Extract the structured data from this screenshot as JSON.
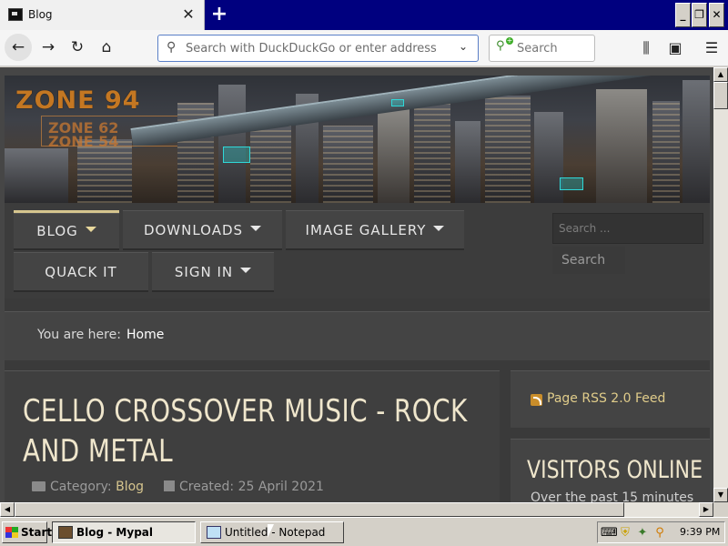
{
  "browser": {
    "tab_title": "Blog",
    "tab_close": "✕",
    "new_tab": "+",
    "url_placeholder": "Search with DuckDuckGo or enter address",
    "search_placeholder": "Search"
  },
  "window_controls": {
    "minimize": "_",
    "maximize": "❐",
    "close": "✕"
  },
  "site": {
    "logo": "ZONE 94",
    "logo_sub_1": "ZONE 62",
    "logo_sub_2": "ZONE 54",
    "menu": [
      {
        "label": "BLOG",
        "dropdown": true,
        "active": true
      },
      {
        "label": "DOWNLOADS",
        "dropdown": true
      },
      {
        "label": "IMAGE GALLERY",
        "dropdown": true
      },
      {
        "label": "QUACK IT",
        "dropdown": false
      },
      {
        "label": "SIGN IN",
        "dropdown": true
      }
    ],
    "search_placeholder": "Search ...",
    "search_button": "Search",
    "breadcrumb_label": "You are here:",
    "breadcrumb_home": "Home",
    "article": {
      "title": "CELLO CROSSOVER MUSIC - ROCK AND METAL",
      "category_label": "Category:",
      "category": "Blog",
      "created": "Created: 25 April 2021"
    },
    "rss_link": "Page RSS 2.0 Feed",
    "visitors_title": "VISITORS ONLINE",
    "visitors_sub": "Over the past 15 minutes"
  },
  "taskbar": {
    "start": "Start",
    "tasks": [
      {
        "label": "Blog - Mypal",
        "active": true
      },
      {
        "label": "Untitled - Notepad",
        "active": false
      }
    ],
    "clock": "9:39 PM"
  },
  "colors": {
    "accent_gold": "#d6c58e",
    "titlebar_blue": "#00007f"
  }
}
